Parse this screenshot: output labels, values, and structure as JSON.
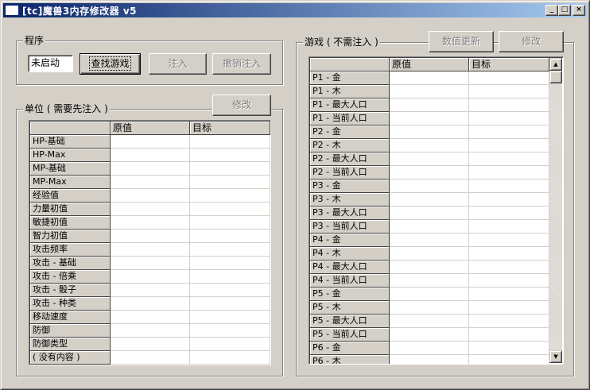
{
  "window": {
    "title": "[tc]魔兽3内存修改器 v5",
    "minimize_glyph": "_",
    "maximize_glyph": "□",
    "close_glyph": "×"
  },
  "program": {
    "group_label": "程序",
    "status_value": "未启动",
    "find_game_label": "查找游戏",
    "inject_label": "注入",
    "uninject_label": "撤销注入"
  },
  "unit": {
    "group_label": "单位 ( 需要先注入 )",
    "modify_label": "修改",
    "headers": [
      "",
      "原值",
      "目标"
    ],
    "rows": [
      "HP-基础",
      "HP-Max",
      "MP-基础",
      "MP-Max",
      "经验值",
      "力量初值",
      "敏捷初值",
      "智力初值",
      "攻击频率",
      "攻击 - 基础",
      "攻击 - 倍乘",
      "攻击 - 骰子",
      "攻击 - 种类",
      "移动速度",
      "防御",
      "防御类型",
      "( 没有内容 )"
    ]
  },
  "game": {
    "group_label": "游戏 ( 不需注入 )",
    "refresh_label": "数值更新",
    "modify_label": "修改",
    "headers": [
      "",
      "原值",
      "目标"
    ],
    "rows": [
      "P1 - 金",
      "P1 - 木",
      "P1 - 最大人口",
      "P1 - 当前人口",
      "P2 - 金",
      "P2 - 木",
      "P2 - 最大人口",
      "P2 - 当前人口",
      "P3 - 金",
      "P3 - 木",
      "P3 - 最大人口",
      "P3 - 当前人口",
      "P4 - 金",
      "P4 - 木",
      "P4 - 最大人口",
      "P4 - 当前人口",
      "P5 - 金",
      "P5 - 木",
      "P5 - 最大人口",
      "P5 - 当前人口",
      "P6 - 金",
      "P6 - 木"
    ],
    "scroll_up_glyph": "▲",
    "scroll_down_glyph": "▼"
  }
}
